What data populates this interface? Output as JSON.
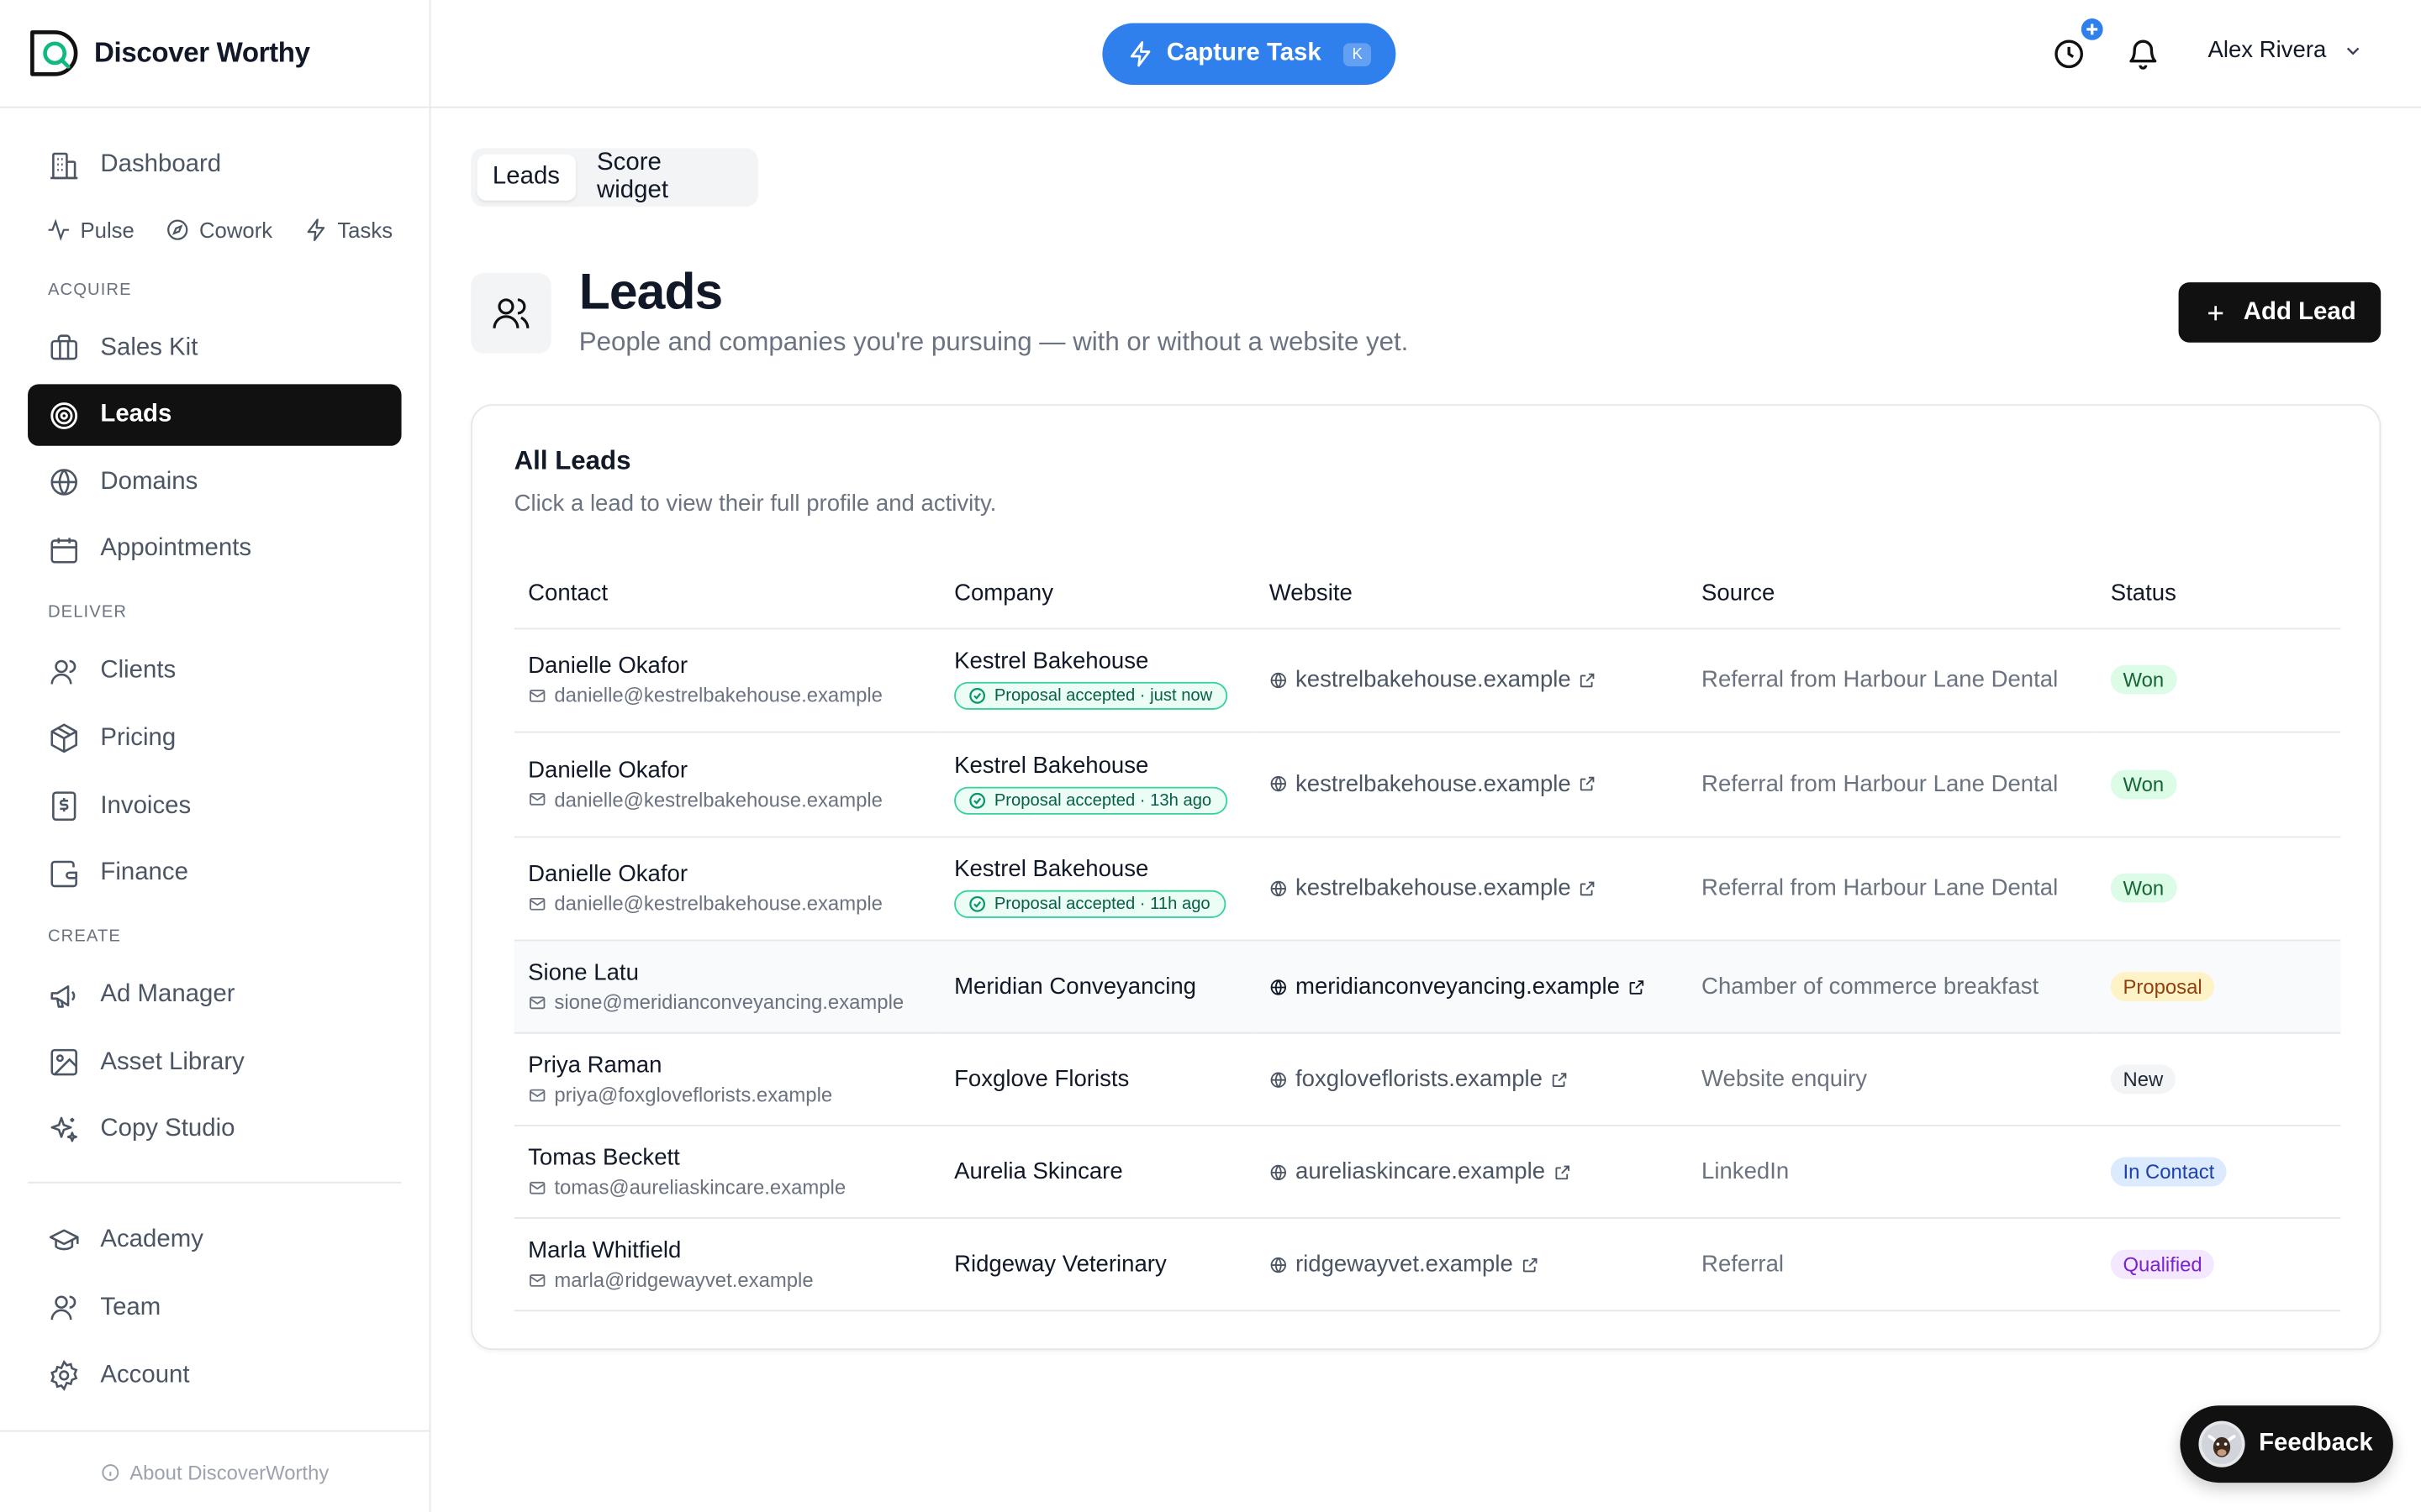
{
  "brand": {
    "name": "Discover Worthy"
  },
  "sidebar": {
    "dashboard": "Dashboard",
    "subnav": [
      "Pulse",
      "Cowork",
      "Tasks"
    ],
    "acquire_label": "ACQUIRE",
    "acquire": [
      "Sales Kit",
      "Leads",
      "Domains",
      "Appointments"
    ],
    "deliver_label": "DELIVER",
    "deliver": [
      "Clients",
      "Pricing",
      "Invoices",
      "Finance"
    ],
    "create_label": "CREATE",
    "create": [
      "Ad Manager",
      "Asset Library",
      "Copy Studio"
    ],
    "bottom": [
      "Academy",
      "Team",
      "Account"
    ],
    "about": "About DiscoverWorthy"
  },
  "topbar": {
    "capture_label": "Capture Task",
    "capture_shortcut": "K",
    "user_name": "Alex Rivera"
  },
  "tabs": [
    "Leads",
    "Score widget"
  ],
  "page": {
    "title": "Leads",
    "subtitle": "People and companies you're pursuing — with or without a website yet.",
    "add_label": "Add Lead"
  },
  "card": {
    "title": "All Leads",
    "subtitle": "Click a lead to view their full profile and activity."
  },
  "table": {
    "headers": [
      "Contact",
      "Company",
      "Website",
      "Source",
      "Status"
    ],
    "rows": [
      {
        "name": "Danielle Okafor",
        "email": "danielle@kestrelbakehouse.example",
        "company": "Kestrel Bakehouse",
        "badge": "Proposal accepted · just now",
        "website": "kestrelbakehouse.example",
        "source": "Referral from Harbour Lane Dental",
        "status": "Won"
      },
      {
        "name": "Danielle Okafor",
        "email": "danielle@kestrelbakehouse.example",
        "company": "Kestrel Bakehouse",
        "badge": "Proposal accepted · 13h ago",
        "website": "kestrelbakehouse.example",
        "source": "Referral from Harbour Lane Dental",
        "status": "Won"
      },
      {
        "name": "Danielle Okafor",
        "email": "danielle@kestrelbakehouse.example",
        "company": "Kestrel Bakehouse",
        "badge": "Proposal accepted · 11h ago",
        "website": "kestrelbakehouse.example",
        "source": "Referral from Harbour Lane Dental",
        "status": "Won"
      },
      {
        "name": "Sione Latu",
        "email": "sione@meridianconveyancing.example",
        "company": "Meridian Conveyancing",
        "badge": "",
        "website": "meridianconveyancing.example",
        "source": "Chamber of commerce breakfast",
        "status": "Proposal"
      },
      {
        "name": "Priya Raman",
        "email": "priya@foxgloveflorists.example",
        "company": "Foxglove Florists",
        "badge": "",
        "website": "foxgloveflorists.example",
        "source": "Website enquiry",
        "status": "New"
      },
      {
        "name": "Tomas Beckett",
        "email": "tomas@aureliaskincare.example",
        "company": "Aurelia Skincare",
        "badge": "",
        "website": "aureliaskincare.example",
        "source": "LinkedIn",
        "status": "In Contact"
      },
      {
        "name": "Marla Whitfield",
        "email": "marla@ridgewayvet.example",
        "company": "Ridgeway Veterinary",
        "badge": "",
        "website": "ridgewayvet.example",
        "source": "Referral",
        "status": "Qualified"
      }
    ]
  },
  "status_colors": {
    "Won": {
      "bg": "#dcfce7",
      "fg": "#166534"
    },
    "Proposal": {
      "bg": "#fef3c7",
      "fg": "#92400e"
    },
    "New": {
      "bg": "#f3f4f6",
      "fg": "#1f2937"
    },
    "In Contact": {
      "bg": "#dbeafe",
      "fg": "#1e40af"
    },
    "Qualified": {
      "bg": "#f3e8ff",
      "fg": "#7e22ce"
    }
  },
  "colors": {
    "accent": "#2f80ed",
    "active_nav": "#111111"
  },
  "feedback": {
    "label": "Feedback"
  }
}
